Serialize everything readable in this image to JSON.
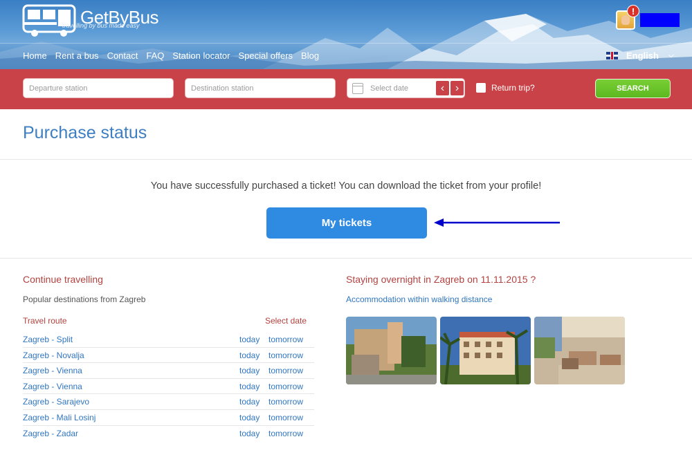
{
  "brand": {
    "name": "GetByBus",
    "tagline": "travelling by bus made easy"
  },
  "nav": {
    "items": [
      "Home",
      "Rent a bus",
      "Contact",
      "FAQ",
      "Station locator",
      "Special offers",
      "Blog"
    ],
    "language": "English"
  },
  "user": {
    "alert_badge": "!"
  },
  "search": {
    "departure_placeholder": "Departure station",
    "destination_placeholder": "Destination station",
    "date_placeholder": "Select date",
    "prev_label": "‹",
    "next_label": "›",
    "return_trip_label": "Return trip?",
    "button_label": "SEARCH"
  },
  "page": {
    "title": "Purchase status",
    "success_message": "You have successfully purchased a ticket! You can download the ticket from your profile!",
    "my_tickets_label": "My tickets"
  },
  "continue": {
    "title": "Continue travelling",
    "subtitle": "Popular destinations from Zagreb",
    "col_route": "Travel route",
    "col_date": "Select date",
    "routes": [
      {
        "name": "Zagreb - Split",
        "today": "today",
        "tomorrow": "tomorrow"
      },
      {
        "name": "Zagreb - Novalja",
        "today": "today",
        "tomorrow": "tomorrow"
      },
      {
        "name": "Zagreb - Vienna",
        "today": "today",
        "tomorrow": "tomorrow"
      },
      {
        "name": "Zagreb - Vienna",
        "today": "today",
        "tomorrow": "tomorrow"
      },
      {
        "name": "Zagreb - Sarajevo",
        "today": "today",
        "tomorrow": "tomorrow"
      },
      {
        "name": "Zagreb - Mali Losinj",
        "today": "today",
        "tomorrow": "tomorrow"
      },
      {
        "name": "Zagreb - Zadar",
        "today": "today",
        "tomorrow": "tomorrow"
      }
    ]
  },
  "overnight": {
    "title": "Staying overnight in Zagreb on 11.11.2015 ?",
    "link": "Accommodation within walking distance"
  },
  "colors": {
    "header_blue": "#4a8fd0",
    "search_bar_red": "#c94247",
    "title_blue": "#3e7fc1",
    "button_blue": "#2f8ae2",
    "search_green": "#6cc22a",
    "section_red": "#b1423f",
    "link_blue": "#2f76c0",
    "annotation_arrow": "#0000cc",
    "redaction_block": "#0000ff"
  }
}
